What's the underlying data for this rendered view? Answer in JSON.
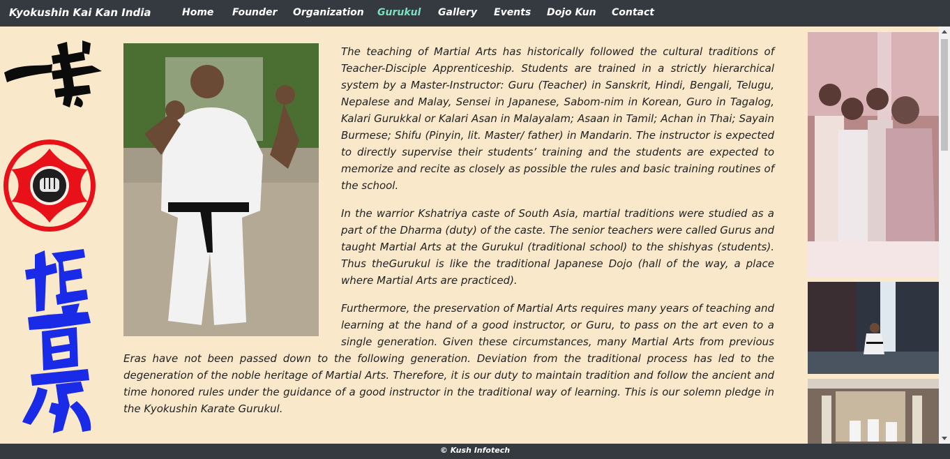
{
  "navbar": {
    "brand": "Kyokushin Kai Kan India",
    "items": [
      {
        "label": "Home"
      },
      {
        "label": "Founder"
      },
      {
        "label": "Organization"
      },
      {
        "label": "Gurukul"
      },
      {
        "label": "Gallery"
      },
      {
        "label": "Events"
      },
      {
        "label": "Dojo Kun"
      },
      {
        "label": "Contact"
      }
    ],
    "active_item": "Gurukul"
  },
  "colors": {
    "navbar_bg": "#343a40",
    "page_bg": "#f9e8c9",
    "active_link": "#7de0c0",
    "kanku_red": "#e8111a",
    "kanji_blue": "#1a2be8"
  },
  "content": {
    "paragraphs": [
      "The teaching of Martial Arts has historically followed the cultural traditions of Teacher-Disciple Apprenticeship. Students are trained in a strictly hierarchical system by a Master-Instructor: Guru (Teacher) in Sanskrit, Hindi, Bengali, Telugu, Nepalese and Malay, Sensei in Japanese, Sabom-nim in Korean, Guro in Tagalog, Kalari Gurukkal or Kalari Asan in Malayalam; Asaan in Tamil; Achan in Thai; Sayain Burmese; Shifu (Pinyin, lit. Master/ father) in Mandarin. The instructor is expected to directly supervise their students’ training and the students are expected to memorize and recite as closely as possible the rules and basic training routines of the school.",
      "In the warrior Kshatriya caste of South Asia, martial traditions were studied as a part of the Dharma (duty) of the caste. The senior teachers were called Gurus and taught Martial Arts at the Gurukul (traditional school) to the shishyas (students). Thus theGurukul is like the traditional Japanese Dojo (hall of the way, a place where Martial Arts are practiced).",
      "Furthermore, the preservation of Martial Arts requires many years of teaching and learning at the hand of a good instructor, or Guru, to pass on the art even to a single generation. Given these circumstances, many Martial Arts from previous Eras have not been passed down to the following generation. Deviation from the traditional process has led to the degeneration of the noble heritage of Martial Arts. Therefore, it is our duty to maintain tradition and follow the ancient and time honored rules under the guidance of a good instructor in the traditional way of learning. This is our solemn pledge in the Kyokushin Karate Gurukul."
    ]
  },
  "footer": {
    "text": "© Kush Infotech"
  }
}
